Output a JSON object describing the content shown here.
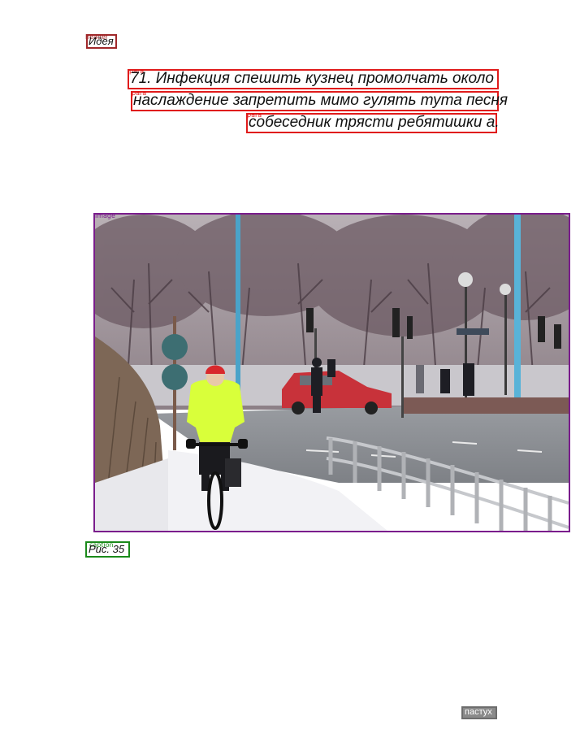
{
  "header": {
    "tag": "header",
    "text": "Идея"
  },
  "paragraph": {
    "tag": "para",
    "lines": [
      "71. Инфекция спешить кузнец промолчать около",
      "наслаждение запретить мимо гулять тута песня",
      "собеседник трясти ребятишки а."
    ]
  },
  "figure": {
    "tag": "image",
    "caption_tag": "caption",
    "caption": "Рис. 35"
  },
  "footer": {
    "text": "пастух"
  },
  "colors": {
    "header": "#a0282a",
    "paragraph": "#e01b1b",
    "image": "#7a1d8c",
    "caption": "#1a8a1a",
    "footer": "#8a8a8a"
  }
}
